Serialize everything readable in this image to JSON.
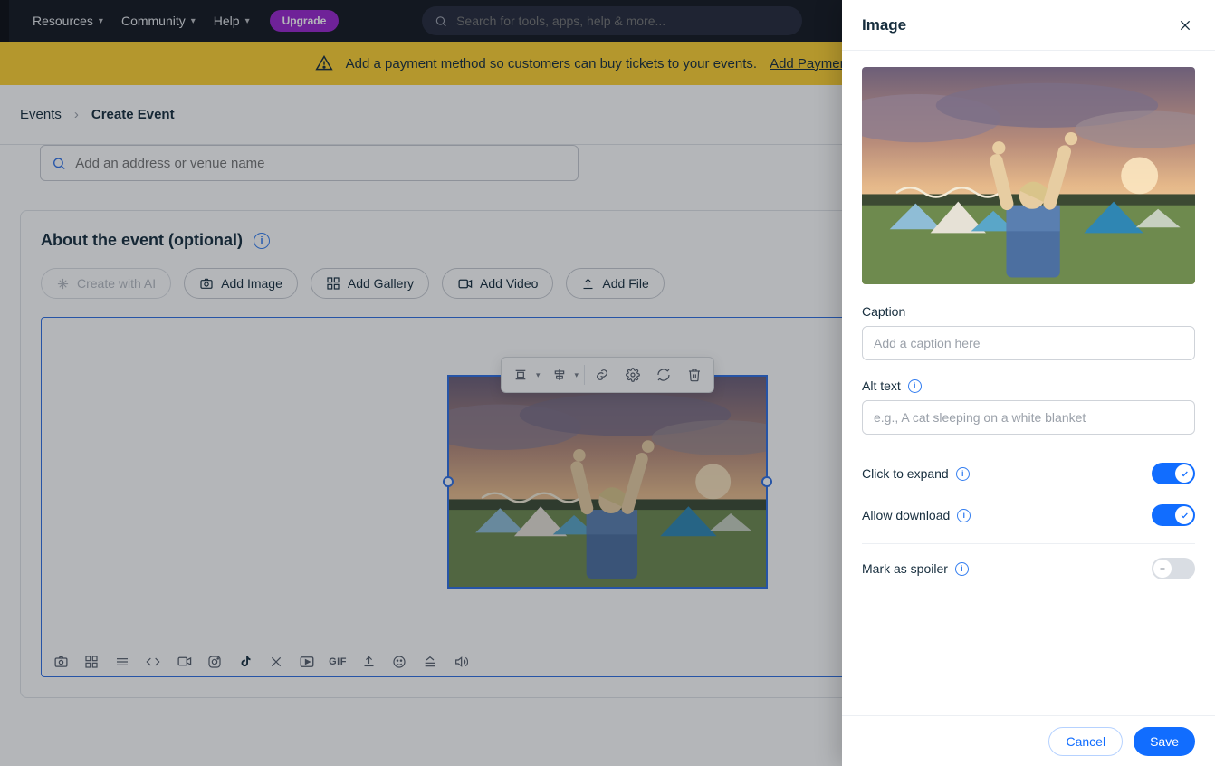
{
  "topnav": {
    "items": [
      "Resources",
      "Community",
      "Help"
    ],
    "upgrade": "Upgrade",
    "search_placeholder": "Search for tools, apps, help & more..."
  },
  "banner": {
    "msg": "Add a payment method so customers can buy tickets to your events.",
    "link": "Add Payment Method"
  },
  "crumbs": {
    "root": "Events",
    "current": "Create Event"
  },
  "address_placeholder": "Add an address or venue name",
  "about": {
    "title": "About the event (optional)",
    "chips": {
      "ai": "Create with AI",
      "image": "Add Image",
      "gallery": "Add Gallery",
      "video": "Add Video",
      "file": "Add File"
    }
  },
  "strip_gif": "GIF",
  "panel": {
    "title": "Image",
    "caption_label": "Caption",
    "caption_placeholder": "Add a caption here",
    "alt_label": "Alt text",
    "alt_placeholder": "e.g., A cat sleeping on a white blanket",
    "toggles": {
      "expand": {
        "label": "Click to expand",
        "on": true
      },
      "download": {
        "label": "Allow download",
        "on": true
      },
      "spoiler": {
        "label": "Mark as spoiler",
        "on": false
      }
    },
    "cancel": "Cancel",
    "save": "Save"
  }
}
